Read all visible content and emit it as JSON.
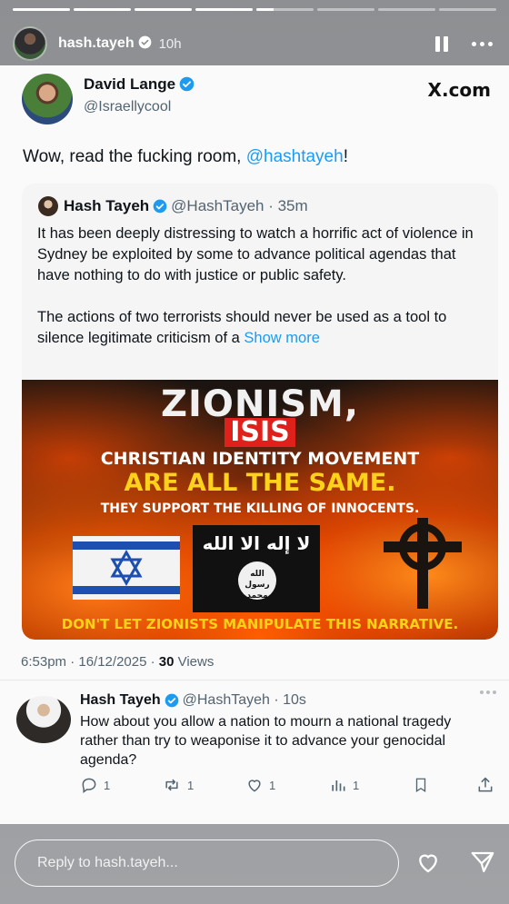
{
  "story": {
    "username": "hash.tayeh",
    "time": "10h",
    "progress": [
      1,
      1,
      1,
      1,
      0.3,
      0,
      0,
      0
    ]
  },
  "tweet": {
    "author_name": "David Lange",
    "author_handle": "@Israellycool",
    "source": "X.com",
    "text_before": "Wow, read the fucking room, ",
    "text_mention": "@hashtayeh",
    "text_after": "!",
    "quote": {
      "name": "Hash Tayeh",
      "handle": "@HashTayeh · 35m",
      "paragraph1": "It has been deeply distressing to watch a horrific act of violence in Sydney be exploited by some to advance political agendas that have nothing to do with justice or public safety.",
      "paragraph2": "The actions of two terrorists should never be used as a tool to silence legitimate criticism of a ",
      "show_more": "Show more",
      "poster": {
        "line1": "ZIONISM,",
        "line2": "ISIS",
        "line3": "CHRISTIAN IDENTITY MOVEMENT",
        "line4": "ARE ALL THE SAME.",
        "line5": "THEY SUPPORT THE KILLING OF INNOCENTS.",
        "flag_text": "لا إله الا الله",
        "seal_text": "الله رسول محمد",
        "bottom": "DON'T LET ZIONISTS MANIPULATE THIS NARRATIVE."
      }
    },
    "meta_time": "6:53pm · 16/12/2025 · ",
    "meta_views_count": "30",
    "meta_views_label": " Views"
  },
  "reply": {
    "name": "Hash Tayeh",
    "handle": "@HashTayeh · 10s",
    "text": "How about you allow a nation to mourn a national tragedy rather than try to weaponise it to advance your genocidal agenda?",
    "counts": {
      "replies": "1",
      "reposts": "1",
      "likes": "1",
      "views": "1"
    }
  },
  "reply_bar": {
    "placeholder": "Reply to hash.tayeh..."
  },
  "colors": {
    "accent": "#1d9bf0",
    "verified": "#1d9bf0"
  }
}
